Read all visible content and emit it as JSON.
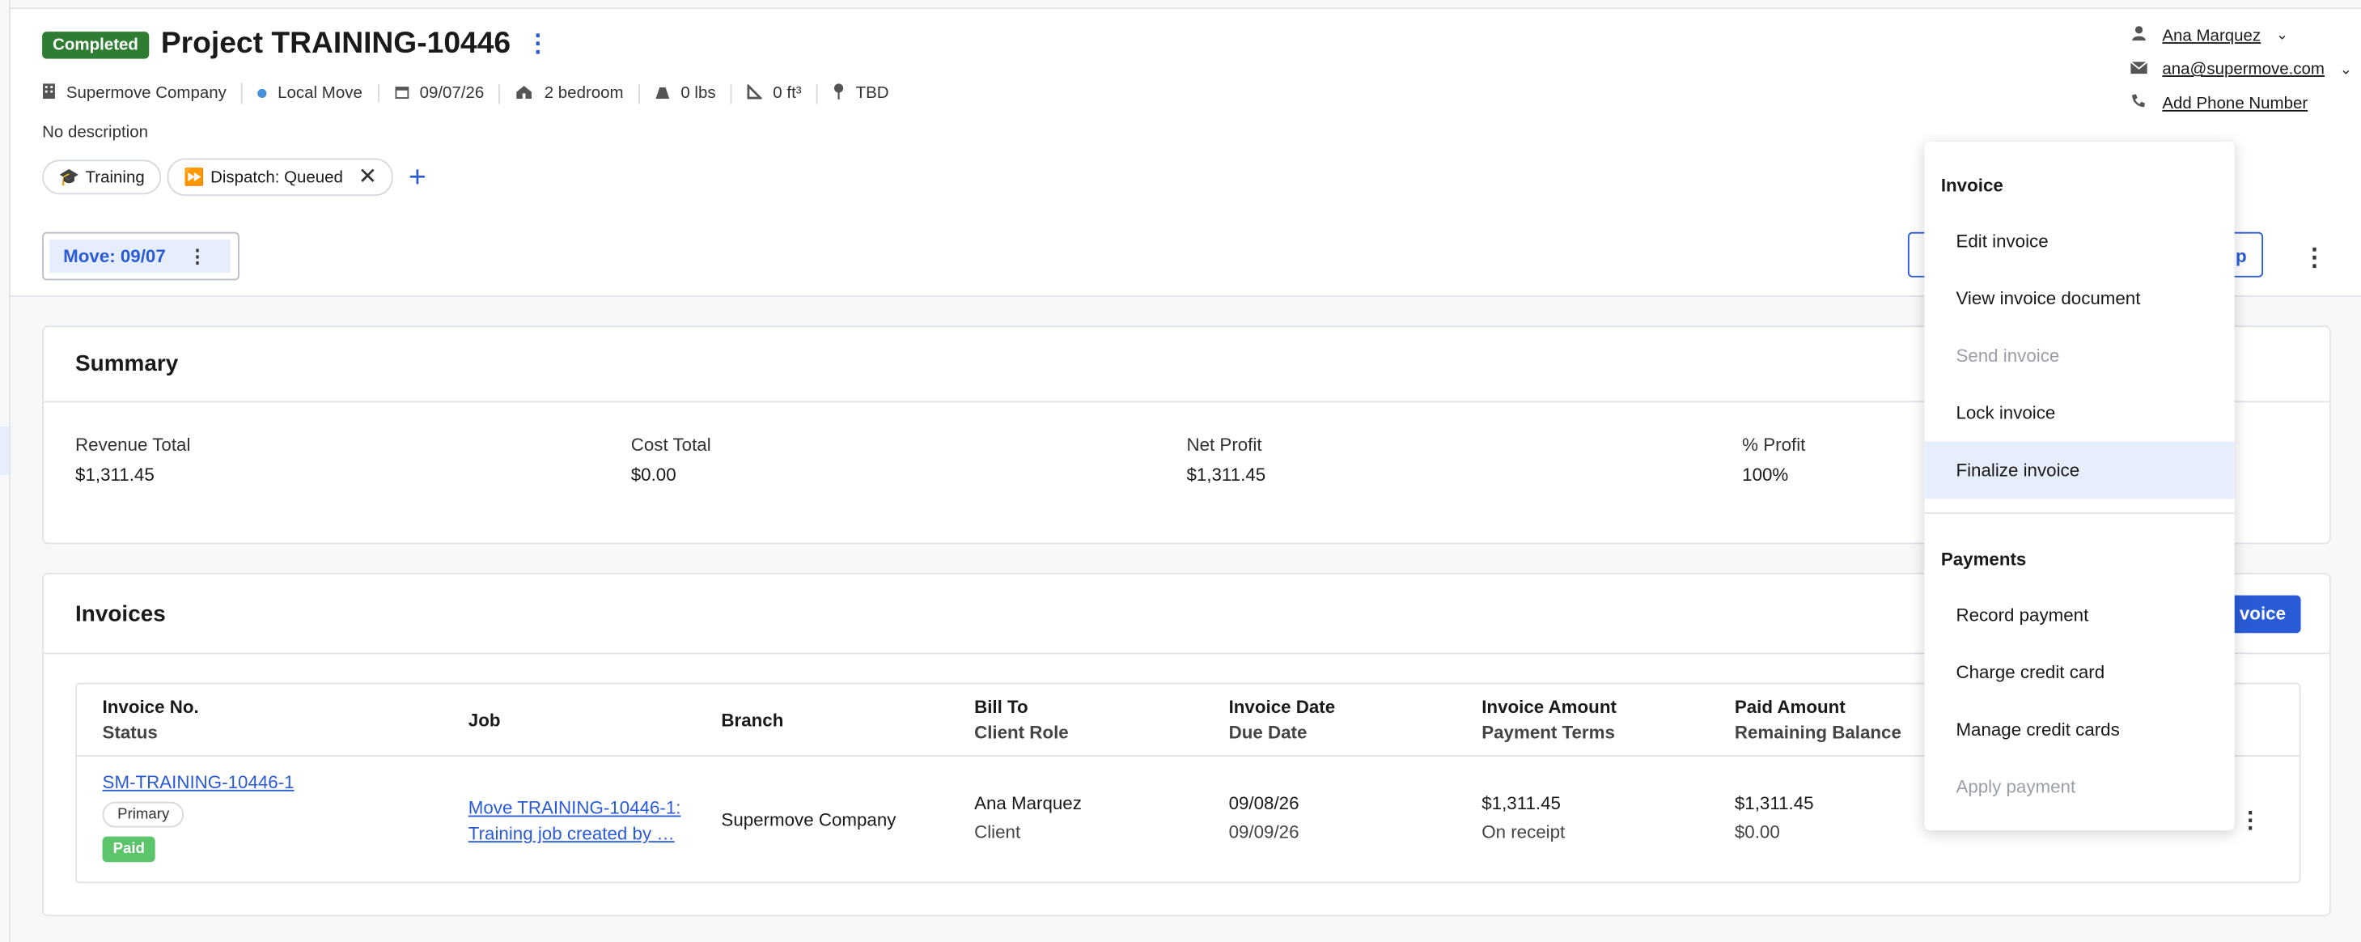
{
  "project": {
    "status_badge": "Completed",
    "title": "Project TRAINING-10446",
    "kebab_icon": "⋮",
    "company": "Supermove Company",
    "move_type": "Local Move",
    "date": "09/07/26",
    "size": "2 bedroom",
    "weight": "0 lbs",
    "volume": "0 ft³",
    "location": "TBD",
    "description": "No description",
    "tags": [
      {
        "emoji": "🎓",
        "label": "Training"
      },
      {
        "emoji": "⏩",
        "label": "Dispatch: Queued"
      }
    ],
    "add_tag_icon": "+"
  },
  "contact": {
    "name": "Ana Marquez",
    "email": "ana@supermove.com",
    "phone": "Add Phone Number"
  },
  "move_tab": {
    "label": "Move: 09/07",
    "kebab_icon": "⋮"
  },
  "top_button_label": "p",
  "summary": {
    "title": "Summary",
    "cols": [
      {
        "label": "Revenue Total",
        "value": "$1,311.45"
      },
      {
        "label": "Cost Total",
        "value": "$0.00"
      },
      {
        "label": "Net Profit",
        "value": "$1,311.45"
      },
      {
        "label": "% Profit",
        "value": "100%"
      }
    ]
  },
  "invoices": {
    "title": "Invoices",
    "new_button_label": "voice",
    "headers": {
      "invoice_no": "Invoice No.",
      "status": "Status",
      "job": "Job",
      "branch": "Branch",
      "bill_to": "Bill To",
      "client_role": "Client Role",
      "invoice_date": "Invoice Date",
      "due_date": "Due Date",
      "invoice_amount": "Invoice Amount",
      "payment_terms": "Payment Terms",
      "paid_amount": "Paid Amount",
      "remaining_balance": "Remaining Balance"
    },
    "row": {
      "invoice_no": "SM-TRAINING-10446-1",
      "primary_label": "Primary",
      "status": "Paid",
      "job_line1": "Move TRAINING-10446-1:",
      "job_line2": "Training job created by …",
      "branch": "Supermove Company",
      "bill_to": "Ana Marquez",
      "client_role": "Client",
      "invoice_date": "09/08/26",
      "due_date": "09/09/26",
      "invoice_amount": "$1,311.45",
      "payment_terms": "On receipt",
      "paid_amount": "$1,311.45",
      "remaining_balance": "$0.00"
    }
  },
  "menu": {
    "invoice_section": "Invoice",
    "edit": "Edit invoice",
    "view": "View invoice document",
    "send": "Send invoice",
    "lock": "Lock invoice",
    "finalize": "Finalize invoice",
    "payments_section": "Payments",
    "record": "Record payment",
    "charge": "Charge credit card",
    "manage": "Manage credit cards",
    "apply": "Apply payment"
  },
  "colors": {
    "accent": "#2a5bd7",
    "completed": "#2e7d32",
    "paid": "#5cc46a",
    "highlight": "#e6eefc"
  }
}
